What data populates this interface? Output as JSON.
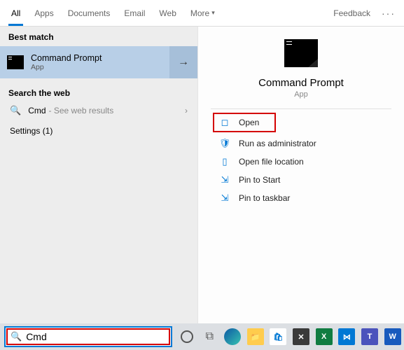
{
  "tabs": {
    "all": "All",
    "apps": "Apps",
    "documents": "Documents",
    "email": "Email",
    "web": "Web",
    "more": "More",
    "feedback": "Feedback"
  },
  "left": {
    "best_match_label": "Best match",
    "result_title": "Command Prompt",
    "result_sub": "App",
    "search_web_label": "Search the web",
    "web_query": "Cmd",
    "web_sub": "- See web results",
    "settings_label": "Settings (1)"
  },
  "preview": {
    "title": "Command Prompt",
    "sub": "App"
  },
  "actions": {
    "open": "Open",
    "run_admin": "Run as administrator",
    "file_loc": "Open file location",
    "pin_start": "Pin to Start",
    "pin_taskbar": "Pin to taskbar"
  },
  "search": {
    "value": "Cmd"
  }
}
